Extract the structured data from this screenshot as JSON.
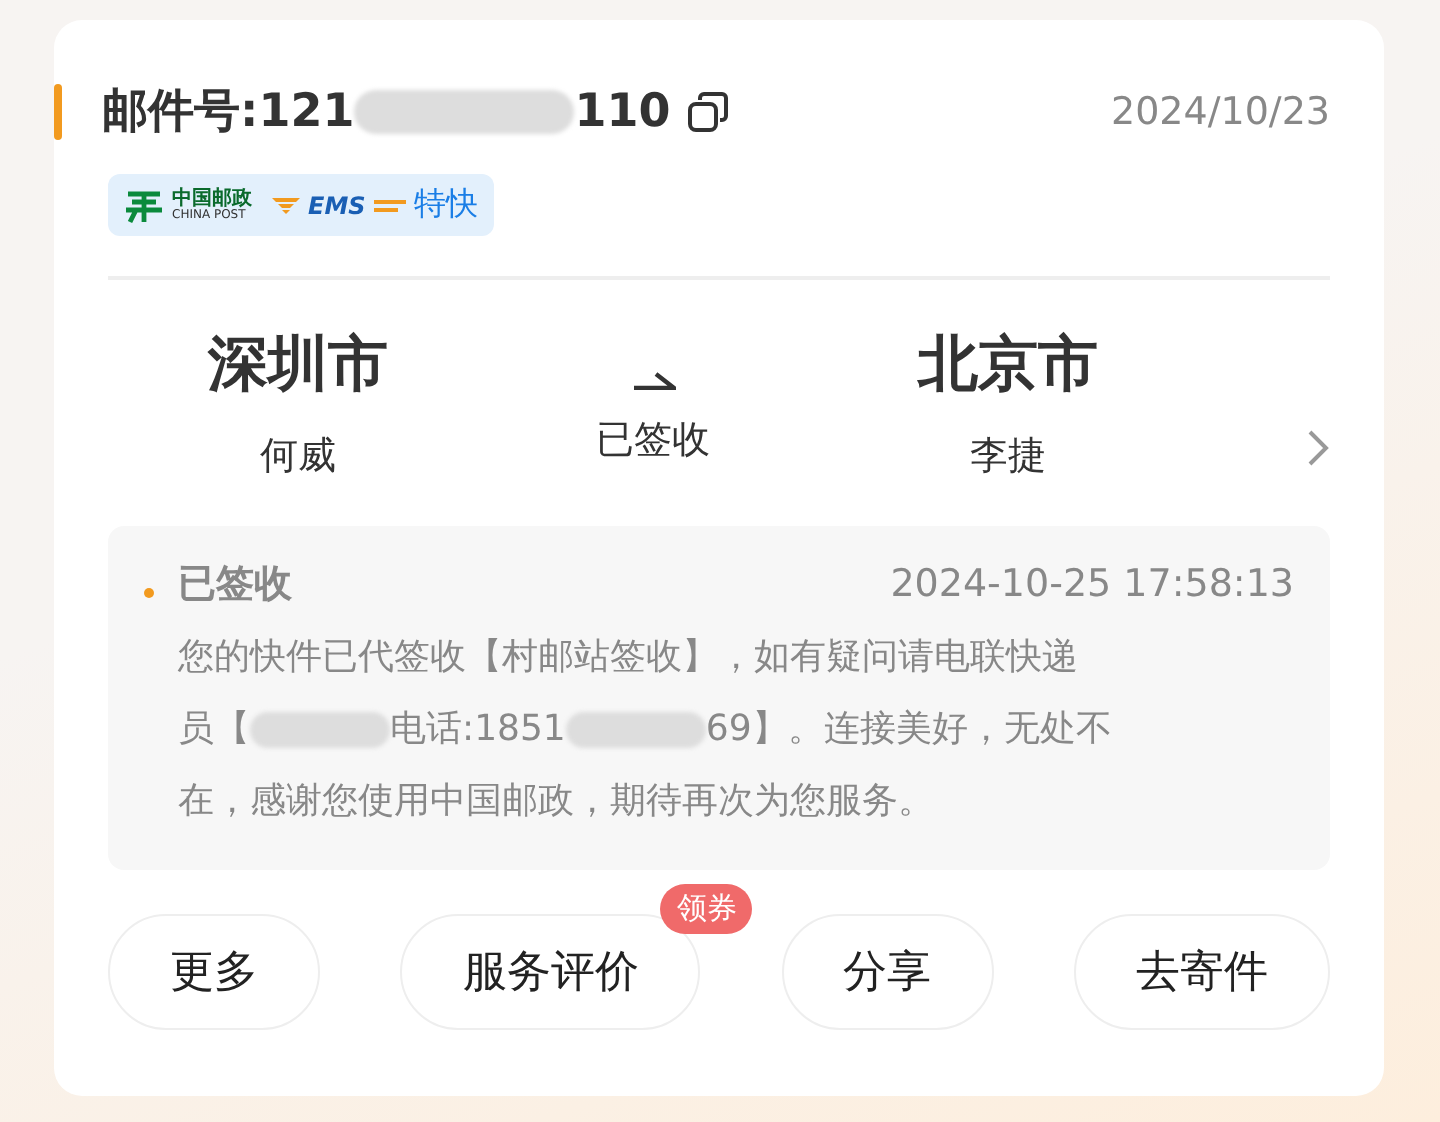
{
  "header": {
    "label": "邮件号:",
    "number_start": "121",
    "number_end": "110",
    "date": "2024/10/23"
  },
  "brand": {
    "name_cn": "中国邮政",
    "name_en": "CHINA POST",
    "service": "EMS",
    "speed": "特快"
  },
  "route": {
    "from": {
      "city": "深圳市",
      "person": "何威"
    },
    "status": "已签收",
    "to": {
      "city": "北京市",
      "person": "李捷"
    }
  },
  "latest": {
    "title": "已签收",
    "time": "2024-10-25 17:58:13",
    "message_lines": [
      [
        {
          "kind": "text",
          "text": "您的快件已代签收【村邮站签收】，如有疑问请电联快递"
        }
      ],
      [
        {
          "kind": "text",
          "text": "员【"
        },
        {
          "kind": "redacted"
        },
        {
          "kind": "text",
          "text": "电话:1851"
        },
        {
          "kind": "redacted"
        },
        {
          "kind": "text",
          "text": "69】。连接美好，无处不"
        }
      ],
      [
        {
          "kind": "text",
          "text": "在，感谢您使用中国邮政，期待再次为您服务。"
        }
      ]
    ]
  },
  "actions": [
    {
      "label": "更多"
    },
    {
      "label": "服务评价",
      "badge": "领券"
    },
    {
      "label": "分享"
    },
    {
      "label": "去寄件"
    }
  ]
}
